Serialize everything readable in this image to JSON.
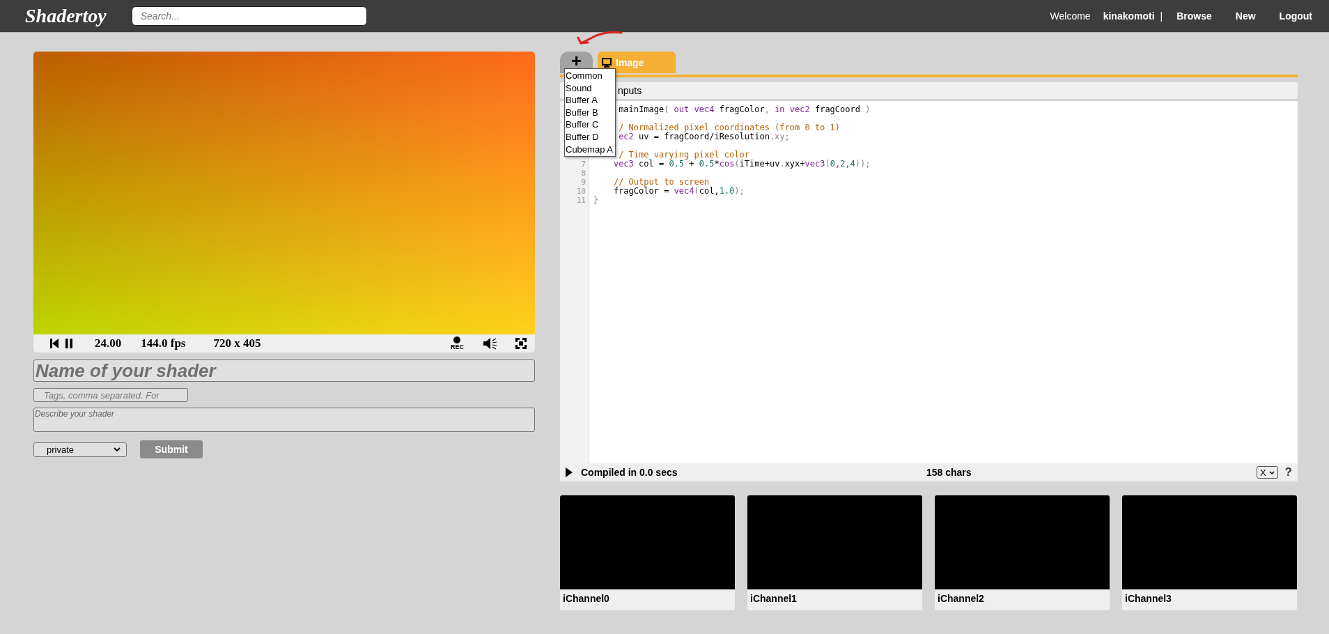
{
  "header": {
    "logo": "Shadertoy",
    "search": {
      "placeholder": "Search..."
    },
    "welcome": "Welcome",
    "user": "kinakomoti",
    "separator": "|",
    "nav": [
      "Browse",
      "New",
      "Logout"
    ]
  },
  "player": {
    "time": "24.00",
    "fps": "144.0 fps",
    "resolution": "720 x 405",
    "rec_label": "REC"
  },
  "shader_form": {
    "name_placeholder": "Name of your shader",
    "tags_placeholder": "Tags, comma separated. For",
    "description_placeholder": "Describe your shader",
    "visibility": "private",
    "submit": "Submit"
  },
  "editor": {
    "add_tab": "+",
    "tabs": [
      {
        "label": "Image",
        "selected": true
      }
    ],
    "add_menu": [
      "Common",
      "Sound",
      "Buffer A",
      "Buffer B",
      "Buffer C",
      "Buffer D",
      "Cubemap A"
    ],
    "inputs_bar": "nputs",
    "lines": [
      {
        "segments": [
          {
            "text": "     mainImage",
            "kind": "ident"
          },
          {
            "text": "(",
            "kind": "punct"
          },
          {
            "text": " out vec4",
            "kind": "keyword"
          },
          {
            "text": " fragColor",
            "kind": "ident"
          },
          {
            "text": ",",
            "kind": "punct"
          },
          {
            "text": " in vec2",
            "kind": "keyword"
          },
          {
            "text": " fragCoord",
            "kind": "ident"
          },
          {
            "text": " )",
            "kind": "punct"
          }
        ]
      },
      {
        "blank_before": true,
        "segments": [
          {
            "text": "     / Normalized pixel coordinates (from 0 to 1)",
            "kind": "comment"
          }
        ]
      },
      {
        "segments": [
          {
            "text": "     ec2",
            "kind": "keyword"
          },
          {
            "text": " uv = fragCoord/iResolution",
            "kind": "ident"
          },
          {
            "text": ".xy;",
            "kind": "punct"
          }
        ]
      },
      {
        "blank_before": true,
        "segments": [
          {
            "text": "     / Time varying pixel color",
            "kind": "comment"
          }
        ]
      },
      {
        "number": "7",
        "segments": [
          {
            "text": "    vec3",
            "kind": "keyword"
          },
          {
            "text": " col = ",
            "kind": "ident"
          },
          {
            "text": "0.5",
            "kind": "number"
          },
          {
            "text": " + ",
            "kind": "ident"
          },
          {
            "text": "0.5",
            "kind": "number"
          },
          {
            "text": "*",
            "kind": "ident"
          },
          {
            "text": "cos",
            "kind": "keyword"
          },
          {
            "text": "(",
            "kind": "punct"
          },
          {
            "text": "iTime+uv",
            "kind": "ident"
          },
          {
            "text": ".",
            "kind": "punct"
          },
          {
            "text": "xyx+",
            "kind": "ident"
          },
          {
            "text": "vec3",
            "kind": "keyword"
          },
          {
            "text": "(",
            "kind": "punct"
          },
          {
            "text": "0,2,4",
            "kind": "number"
          },
          {
            "text": "));",
            "kind": "punct"
          }
        ]
      },
      {
        "number": "8"
      },
      {
        "number": "9",
        "segments": [
          {
            "text": "    // Output to screen",
            "kind": "comment"
          }
        ]
      },
      {
        "number": "10",
        "segments": [
          {
            "text": "    fragColor = ",
            "kind": "ident"
          },
          {
            "text": "vec4",
            "kind": "keyword"
          },
          {
            "text": "(",
            "kind": "punct"
          },
          {
            "text": "col,",
            "kind": "ident"
          },
          {
            "text": "1.0",
            "kind": "number"
          },
          {
            "text": ");",
            "kind": "punct"
          }
        ]
      },
      {
        "number": "11",
        "segments": [
          {
            "text": "}",
            "kind": "punct"
          }
        ]
      }
    ],
    "status": {
      "compiled": "Compiled in 0.0 secs",
      "chars": "158 chars",
      "font_select": "X",
      "help": "?"
    }
  },
  "channels": [
    {
      "label": "iChannel0"
    },
    {
      "label": "iChannel1"
    },
    {
      "label": "iChannel2"
    },
    {
      "label": "iChannel3"
    }
  ]
}
